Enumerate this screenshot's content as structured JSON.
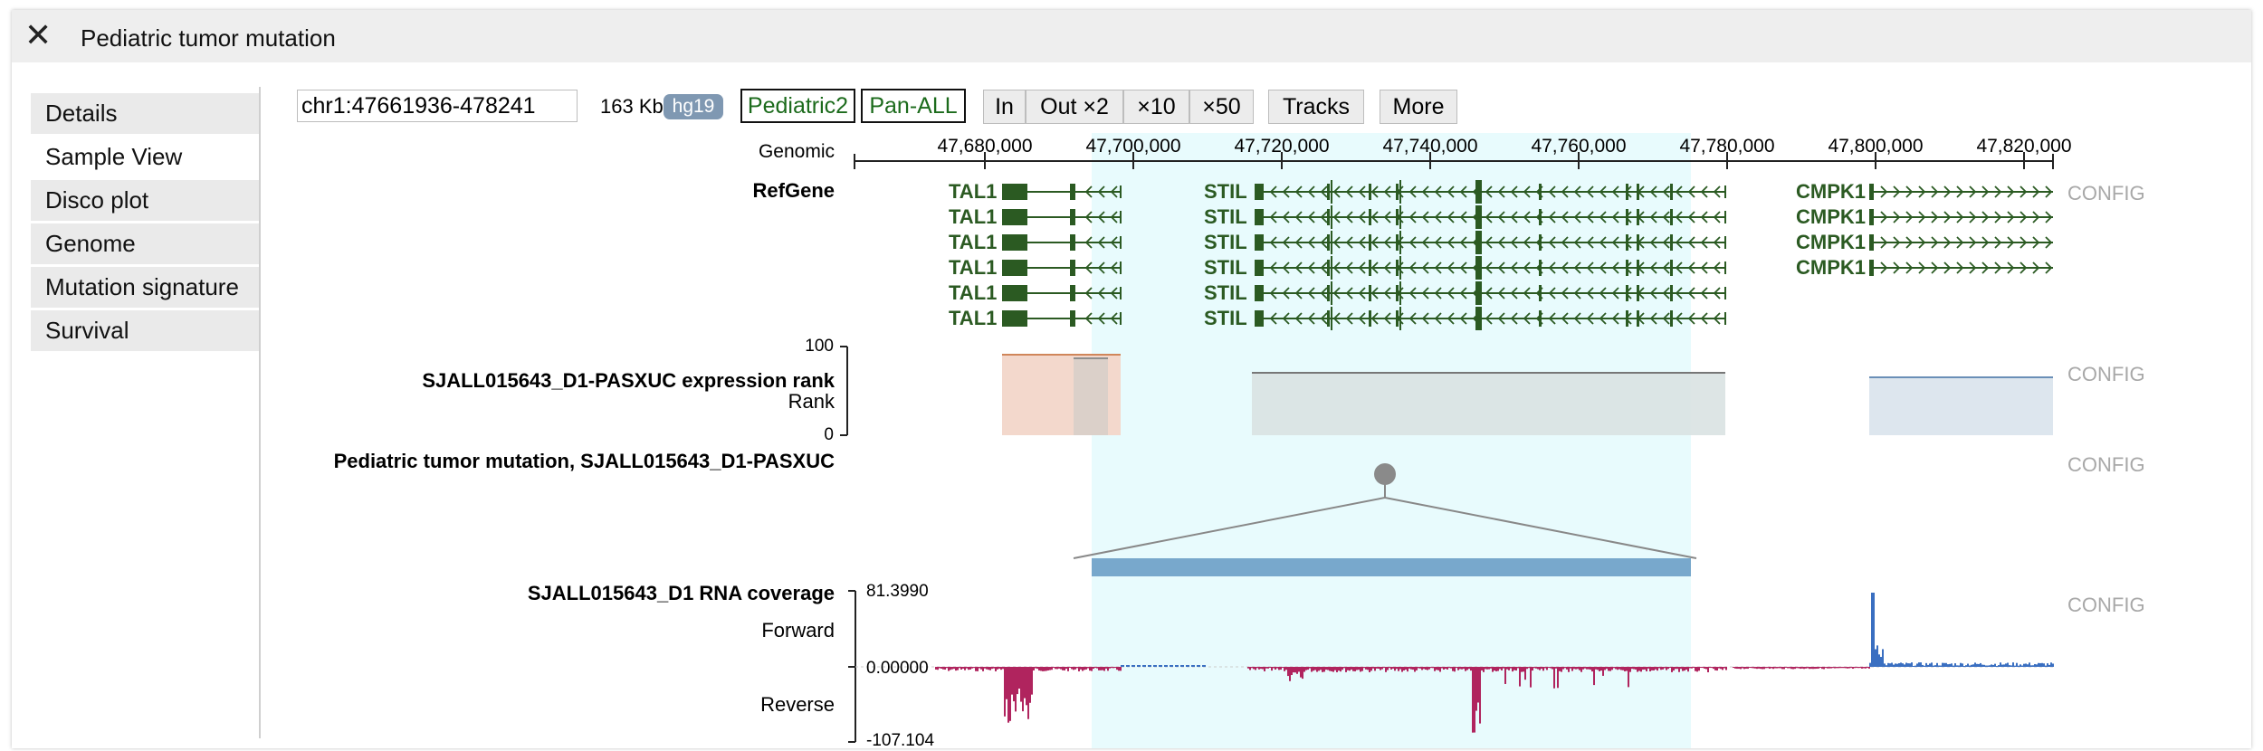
{
  "window": {
    "title": "Pediatric tumor mutation",
    "close_label": "✕"
  },
  "sidebar": {
    "items": [
      {
        "label": "Details"
      },
      {
        "label": "Sample View"
      },
      {
        "label": "Disco plot"
      },
      {
        "label": "Genome"
      },
      {
        "label": "Mutation signature"
      },
      {
        "label": "Survival"
      }
    ]
  },
  "toolbar": {
    "coordinate": "chr1:47661936-478241",
    "span": "163 Kb",
    "genome": "hg19",
    "dataset_buttons": [
      "Pediatric2",
      "Pan-ALL"
    ],
    "zoom_in": "In",
    "zoom_out2": "Out ×2",
    "zoom_out10": "×10",
    "zoom_out50": "×50",
    "tracks": "Tracks",
    "more": "More"
  },
  "ruler": {
    "label": "Genomic",
    "ticks": [
      "47,680,000",
      "47,700,000",
      "47,720,000",
      "47,740,000",
      "47,760,000",
      "47,780,000",
      "47,800,000",
      "47,820,000"
    ]
  },
  "refgene": {
    "label": "RefGene",
    "config": "CONFIG",
    "genes": [
      {
        "name": "TAL1",
        "count": 6
      },
      {
        "name": "STIL",
        "count": 6
      },
      {
        "name": "CMPK1",
        "count": 4
      }
    ]
  },
  "expression": {
    "title": "SJALL015643_D1-PASXUC expression rank",
    "sublabel": "Rank",
    "ymax": "100",
    "ymin": "0",
    "config": "CONFIG"
  },
  "mutation": {
    "title": "Pediatric tumor mutation, SJALL015643_D1-PASXUC",
    "config": "CONFIG"
  },
  "coverage": {
    "title": "SJALL015643_D1 RNA coverage",
    "forward": "Forward",
    "reverse": "Reverse",
    "ymax": "81.3990",
    "zero": "0.00000",
    "ymin": "-107.104",
    "config": "CONFIG"
  },
  "colors": {
    "highlight": "#e8fbfd",
    "gene": "#2b5a22",
    "forward": "#3a6fc1",
    "reverse": "#b0245e",
    "mutation_bar": "#78a8cc"
  }
}
